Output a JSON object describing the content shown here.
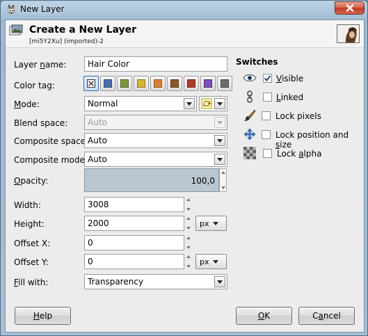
{
  "window": {
    "title": "New Layer",
    "icon": "gimp-wilber-icon"
  },
  "header": {
    "title": "Create a New Layer",
    "subtitle": "[mi5Y2Xu] (imported)-2",
    "thumbnail": "image-thumbnail"
  },
  "form": {
    "layer_name": {
      "label_pre": "Layer ",
      "label_u": "n",
      "label_post": "ame:",
      "value": "Hair Color"
    },
    "color_tag": {
      "label": "Color tag:",
      "swatches": [
        {
          "name": "none",
          "color": ""
        },
        {
          "name": "blue",
          "color": "#4b6eaf"
        },
        {
          "name": "green",
          "color": "#7b9a3c"
        },
        {
          "name": "yellow",
          "color": "#d6b63a"
        },
        {
          "name": "orange",
          "color": "#d98036"
        },
        {
          "name": "brown",
          "color": "#8b5a2b"
        },
        {
          "name": "red",
          "color": "#b23a2c"
        },
        {
          "name": "violet",
          "color": "#7a4fb8"
        },
        {
          "name": "gray",
          "color": "#6c6c6c"
        }
      ]
    },
    "mode": {
      "label_u": "M",
      "label_post": "ode:",
      "value": "Normal"
    },
    "blend_space": {
      "label": "Blend space:",
      "value": "Auto"
    },
    "composite_space": {
      "label": "Composite space:",
      "value": "Auto"
    },
    "composite_mode": {
      "label": "Composite mode:",
      "value": "Auto"
    },
    "opacity": {
      "label_u": "O",
      "label_post": "pacity:",
      "value": "100,0",
      "fraction": 1.0
    },
    "width": {
      "label": "Width:",
      "value": "3008"
    },
    "height": {
      "label": "Height:",
      "value": "2000",
      "unit": "px"
    },
    "offset_x": {
      "label": "Offset X:",
      "value": "0"
    },
    "offset_y": {
      "label": "Offset Y:",
      "value": "0",
      "unit": "px"
    },
    "fill_with": {
      "label_u": "F",
      "label_post": "ill with:",
      "value": "Transparency"
    }
  },
  "switches": {
    "title": "Switches",
    "items": [
      {
        "icon": "eye-icon",
        "label_u": "V",
        "label_post": "isible",
        "checked": true
      },
      {
        "icon": "chain-link-icon",
        "label_u": "L",
        "label_post": "inked",
        "checked": false
      },
      {
        "icon": "paintbrush-icon",
        "label": "Lock pixels",
        "checked": false
      },
      {
        "icon": "move-arrows-icon",
        "label_pre": "Lock position and ",
        "label_u": "s",
        "label_post": "ize",
        "checked": false
      },
      {
        "icon": "checkerboard-icon",
        "label_pre": "Lock ",
        "label_u": "a",
        "label_post": "lpha",
        "checked": false
      }
    ]
  },
  "buttons": {
    "help_u": "H",
    "help_post": "elp",
    "ok_u": "O",
    "ok_post": "K",
    "cancel_pre": "C",
    "cancel_u": "a",
    "cancel_post": "ncel"
  }
}
